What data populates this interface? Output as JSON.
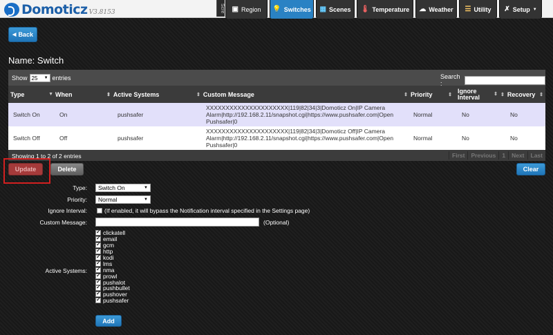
{
  "app": {
    "name": "Domoticz",
    "version": "V3.8153"
  },
  "nav": {
    "screen_tab": "Scre",
    "items": [
      {
        "label": "Region",
        "icon": "monitor-icon"
      },
      {
        "label": "Switches",
        "icon": "bulb-icon"
      },
      {
        "label": "Scenes",
        "icon": "scenes-icon"
      },
      {
        "label": "Temperature",
        "icon": "thermometer-icon"
      },
      {
        "label": "Weather",
        "icon": "cloud-icon"
      },
      {
        "label": "Utility",
        "icon": "utility-icon"
      },
      {
        "label": "Setup",
        "icon": "tools-icon"
      }
    ]
  },
  "back_label": "Back",
  "page_title": "Name: Switch",
  "table": {
    "show_label": "Show",
    "page_size": "25",
    "entries_label": "entries",
    "search_label": "Search :",
    "columns": [
      "Type",
      "When",
      "Active Systems",
      "Custom Message",
      "Priority",
      "Ignore Interval",
      "Recovery"
    ],
    "rows": [
      {
        "type": "Switch On",
        "when": "On",
        "systems": "pushsafer",
        "message": "XXXXXXXXXXXXXXXXXXXXX|119|82|34|3|Domoticz On|IP Camera Alarm|http://192.168.2.11/snapshot.cgi|https://www.pushsafer.com|Open Pushsafer|0",
        "priority": "Normal",
        "ignore": "No",
        "recovery": "No"
      },
      {
        "type": "Switch Off",
        "when": "Off",
        "systems": "pushsafer",
        "message": "XXXXXXXXXXXXXXXXXXXXX|119|82|34|3|Domoticz Off|IP Camera Alarm|http://192.168.2.11/snapshot.cgi|https://www.pushsafer.com|Open Pushsafer|0",
        "priority": "Normal",
        "ignore": "No",
        "recovery": "No"
      }
    ],
    "info": "Showing 1 to 2 of 2 entries",
    "pager": {
      "first": "First",
      "previous": "Previous",
      "page": "1",
      "next": "Next",
      "last": "Last"
    }
  },
  "actions": {
    "update": "Update",
    "delete": "Delete",
    "clear": "Clear"
  },
  "form": {
    "type_label": "Type:",
    "type_value": "Switch On",
    "priority_label": "Priority:",
    "priority_value": "Normal",
    "ignore_label": "Ignore Interval:",
    "ignore_hint": "(If enabled, it will bypass the Notification interval specified in the Settings page)",
    "message_label": "Custom Message:",
    "message_value": "",
    "optional": "(Optional)",
    "systems_label": "Active Systems:",
    "systems": [
      "clickatell",
      "email",
      "gcm",
      "http",
      "kodi",
      "lms",
      "nma",
      "prowl",
      "pushalot",
      "pushbullet",
      "pushover",
      "pushsafer"
    ],
    "add_label": "Add"
  },
  "colors": {
    "accent": "#2a82c4",
    "highlight": "#e2e0fa",
    "update_red": "#cc3333"
  }
}
